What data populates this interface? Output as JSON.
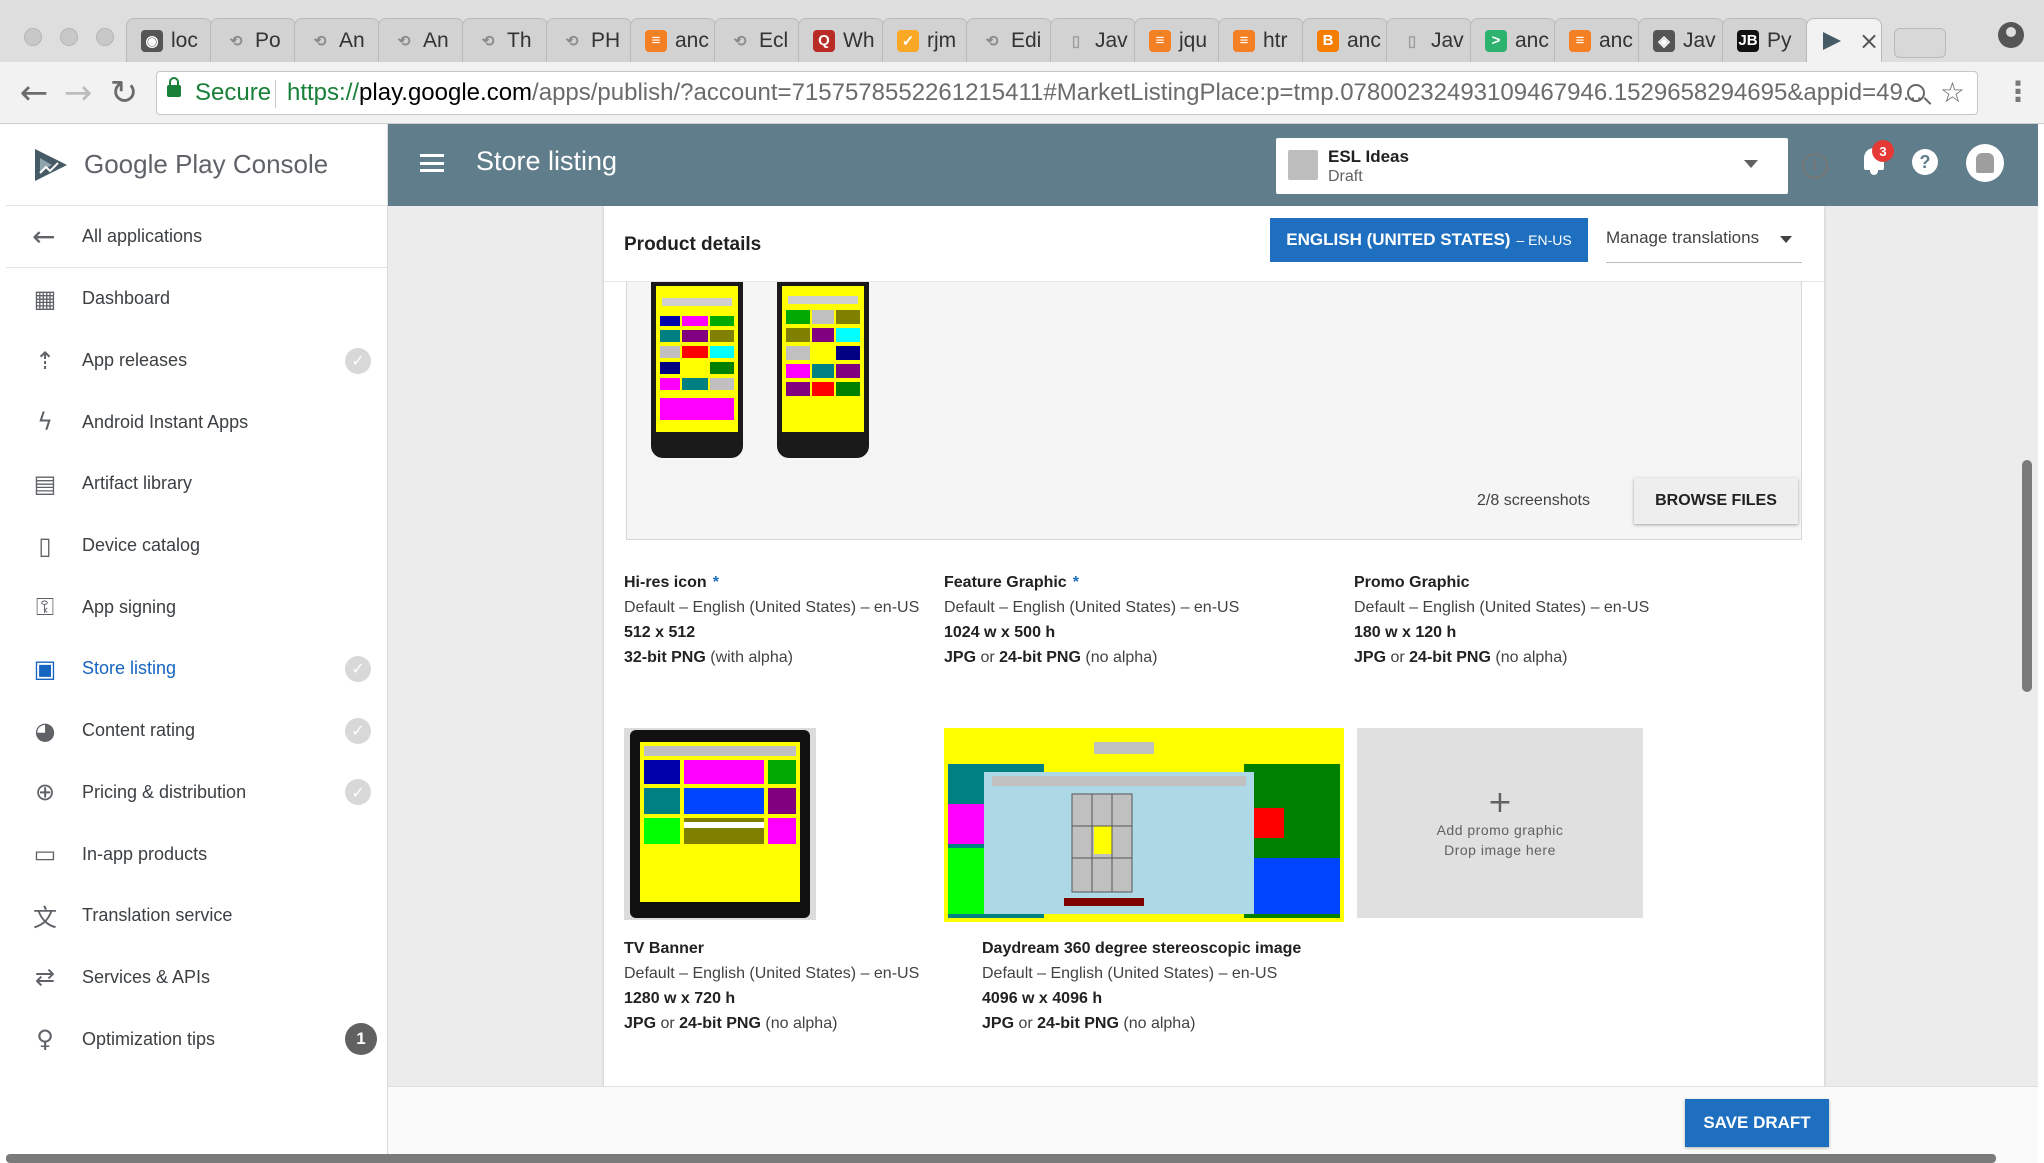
{
  "browser": {
    "tabs": [
      {
        "label": "loc",
        "icon": "github-icon",
        "color": "#555555",
        "glyph": "◉"
      },
      {
        "label": "Po",
        "icon": "loading-icon",
        "color": "#8a8a8a",
        "glyph": "⟲"
      },
      {
        "label": "An",
        "icon": "loading-icon",
        "color": "#8a8a8a",
        "glyph": "⟲"
      },
      {
        "label": "An",
        "icon": "loading-icon",
        "color": "#8a8a8a",
        "glyph": "⟲"
      },
      {
        "label": "Th",
        "icon": "loading-icon",
        "color": "#8a8a8a",
        "glyph": "⟲"
      },
      {
        "label": "PH",
        "icon": "loading-icon",
        "color": "#8a8a8a",
        "glyph": "⟲"
      },
      {
        "label": "anc",
        "icon": "stackoverflow-icon",
        "color": "#f48024",
        "glyph": "≡"
      },
      {
        "label": "Ecl",
        "icon": "loading-icon",
        "color": "#8a8a8a",
        "glyph": "⟲"
      },
      {
        "label": "Wh",
        "icon": "quora-icon",
        "color": "#b92b27",
        "glyph": "Q"
      },
      {
        "label": "rjm",
        "icon": "check-icon",
        "color": "#f9a825",
        "glyph": "✓"
      },
      {
        "label": "Edi",
        "icon": "loading-icon",
        "color": "#8a8a8a",
        "glyph": "⟲"
      },
      {
        "label": "Jav",
        "icon": "page-icon",
        "color": "#9e9e9e",
        "glyph": "▯"
      },
      {
        "label": "jqu",
        "icon": "stackoverflow-icon",
        "color": "#f48024",
        "glyph": "≡"
      },
      {
        "label": "htr",
        "icon": "stackoverflow-icon",
        "color": "#f48024",
        "glyph": "≡"
      },
      {
        "label": "anc",
        "icon": "blogger-icon",
        "color": "#f57d00",
        "glyph": "B"
      },
      {
        "label": "Jav",
        "icon": "page-icon",
        "color": "#9e9e9e",
        "glyph": "▯"
      },
      {
        "label": "anc",
        "icon": "terminal-icon",
        "color": "#2db36f",
        "glyph": ">"
      },
      {
        "label": "anc",
        "icon": "stackoverflow-icon",
        "color": "#f48024",
        "glyph": "≡"
      },
      {
        "label": "Jav",
        "icon": "diamond-icon",
        "color": "#555555",
        "glyph": "◈"
      },
      {
        "label": "Py",
        "icon": "jetbrains-icon",
        "color": "#111111",
        "glyph": "JB"
      }
    ],
    "active_tab": {
      "icon": "play-console-icon",
      "close": "×"
    },
    "secure_label": "Secure",
    "url_scheme": "https://",
    "url_host": "play.google.com",
    "url_path": "/apps/publish/?account=7157578552261215411#MarketListingPlace:p=tmp.07800232493109467946.1529658294695&appid=49..."
  },
  "sidebar": {
    "brand": "Google Play Console",
    "back_label": "All applications",
    "items": [
      {
        "label": "Dashboard",
        "icon": "dashboard-icon",
        "glyph": "▦",
        "check": false
      },
      {
        "label": "App releases",
        "icon": "rocket-icon",
        "glyph": "⇡",
        "check": true
      },
      {
        "label": "Android Instant Apps",
        "icon": "instant-icon",
        "glyph": "ϟ",
        "check": false
      },
      {
        "label": "Artifact library",
        "icon": "library-icon",
        "glyph": "▤",
        "check": false
      },
      {
        "label": "Device catalog",
        "icon": "device-icon",
        "glyph": "▯",
        "check": false
      },
      {
        "label": "App signing",
        "icon": "key-icon",
        "glyph": "⚿",
        "check": false
      },
      {
        "label": "Store listing",
        "icon": "store-icon",
        "glyph": "▣",
        "check": true,
        "active": true
      },
      {
        "label": "Content rating",
        "icon": "rating-icon",
        "glyph": "◕",
        "check": true
      },
      {
        "label": "Pricing & distribution",
        "icon": "globe-icon",
        "glyph": "⊕",
        "check": true
      },
      {
        "label": "In-app products",
        "icon": "card-icon",
        "glyph": "▭",
        "check": false
      },
      {
        "label": "Translation service",
        "icon": "translate-icon",
        "glyph": "文",
        "check": false
      },
      {
        "label": "Services & APIs",
        "icon": "api-icon",
        "glyph": "⇄",
        "check": false
      },
      {
        "label": "Optimization tips",
        "icon": "bulb-icon",
        "glyph": "♀",
        "check": false,
        "badge": "1"
      }
    ]
  },
  "topbar": {
    "title": "Store listing",
    "app_name": "ESL Ideas",
    "app_status": "Draft",
    "notifications": "3",
    "help": "?",
    "info": "i",
    "color": "#607d8b"
  },
  "card": {
    "title": "Product details",
    "lang_main": "ENGLISH (UNITED STATES)",
    "lang_sub": "– EN-US",
    "manage": "Manage translations",
    "shot_count": "2/8 screenshots",
    "browse": "BROWSE FILES"
  },
  "assets": {
    "hires": {
      "title": "Hi-res icon",
      "star": "*",
      "default": "Default – English (United States) – en-US",
      "size": "512 x 512",
      "fmt_bold": "32-bit PNG",
      "fmt_rest": " (with alpha)"
    },
    "feature": {
      "title": "Feature Graphic",
      "star": "*",
      "default": "Default – English (United States) – en-US",
      "size": "1024 w x 500 h",
      "fmt_bold1": "JPG",
      "fmt_mid": " or ",
      "fmt_bold2": "24-bit PNG",
      "fmt_rest": " (no alpha)"
    },
    "promo": {
      "title": "Promo Graphic",
      "default": "Default – English (United States) – en-US",
      "size": "180 w x 120 h",
      "fmt_bold1": "JPG",
      "fmt_mid": " or ",
      "fmt_bold2": "24-bit PNG",
      "fmt_rest": " (no alpha)",
      "drop1": "Add promo graphic",
      "drop2": "Drop image here",
      "plus": "+"
    },
    "tv": {
      "title": "TV Banner",
      "default": "Default – English (United States) – en-US",
      "size": "1280 w x 720 h",
      "fmt_bold1": "JPG",
      "fmt_mid": " or ",
      "fmt_bold2": "24-bit PNG",
      "fmt_rest": " (no alpha)"
    },
    "daydream": {
      "title": "Daydream 360 degree stereoscopic image",
      "default": "Default – English (United States) – en-US",
      "size": "4096 w x 4096 h",
      "fmt_bold1": "JPG",
      "fmt_mid": " or ",
      "fmt_bold2": "24-bit PNG",
      "fmt_rest": " (no alpha)"
    }
  },
  "footer": {
    "save": "SAVE DRAFT"
  },
  "colors": {
    "accent": "#1e6fbf",
    "topbar": "#607d8b",
    "secure": "#188038"
  }
}
